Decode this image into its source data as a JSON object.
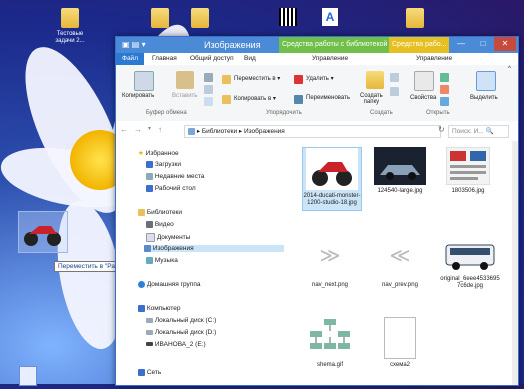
{
  "desktop": {
    "icons": [
      {
        "label": "Тестовые\nзадачи 2..."
      }
    ],
    "drag_tooltip": "Переместить в \"Рабочий стол\"",
    "colors": {
      "accent": "#4a8ad6",
      "ctx_green": "#6fbf4a",
      "ctx_yellow": "#e6c021"
    }
  },
  "window": {
    "title": "Изображения",
    "ctx_tab_library": "Средства работы с библиотекой",
    "ctx_tab_pictures": "Средства рабо...",
    "min_label": "—",
    "max_label": "□",
    "close_label": "✕",
    "tabs": [
      "Файл",
      "Главная",
      "Общий доступ",
      "Вид",
      "Управление",
      "Управление"
    ],
    "ribbon": {
      "copy": "Копировать",
      "paste": "Вставить",
      "move_to": "Переместить в ▾",
      "copy_to": "Копировать в ▾",
      "delete": "Удалить ▾",
      "rename": "Переименовать",
      "new_folder": "Создать\nпапку",
      "properties": "Свойства",
      "select": "Выделить",
      "groups": {
        "clipboard": "Буфер обмена",
        "organize": "Упорядочить",
        "create": "Создать",
        "open": "Открыть"
      }
    },
    "address": {
      "back": "←",
      "forward": "→",
      "up": "↑",
      "path": "▸ Библиотеки ▸ Изображения",
      "search_placeholder": "Поиск: И... 🔍"
    },
    "nav": {
      "favorites": "Избранное",
      "downloads": "Загрузки",
      "recent": "Недавние места",
      "desktop": "Рабочий стол",
      "libraries": "Библиотеки",
      "video": "Видео",
      "documents": "Документы",
      "pictures": "Изображения",
      "music": "Музыка",
      "homegroup": "Домашняя группа",
      "computer": "Компьютер",
      "disk_c": "Локальный диск (C:)",
      "disk_d": "Локальный диск (D:)",
      "disk_e": "ИВАНОВА_2 (E:)",
      "network": "Сеть"
    },
    "files": [
      {
        "name": "2014-ducati-monster-1200-studio-18.jpg",
        "icon": "motorcycle-thumb"
      },
      {
        "name": "124540-large.jpg",
        "icon": "car-thumb"
      },
      {
        "name": "1803506.jpg",
        "icon": "doc-thumb"
      },
      {
        "name": "nav_next.png",
        "icon": "arrow-right-thumb"
      },
      {
        "name": "nav_prev.png",
        "icon": "arrow-left-thumb"
      },
      {
        "name": "original_6eee45336957c6de.jpg",
        "icon": "bus-thumb"
      },
      {
        "name": "shema.gif",
        "icon": "diagram-thumb"
      },
      {
        "name": "схема2",
        "icon": "blank-file-thumb"
      }
    ]
  }
}
